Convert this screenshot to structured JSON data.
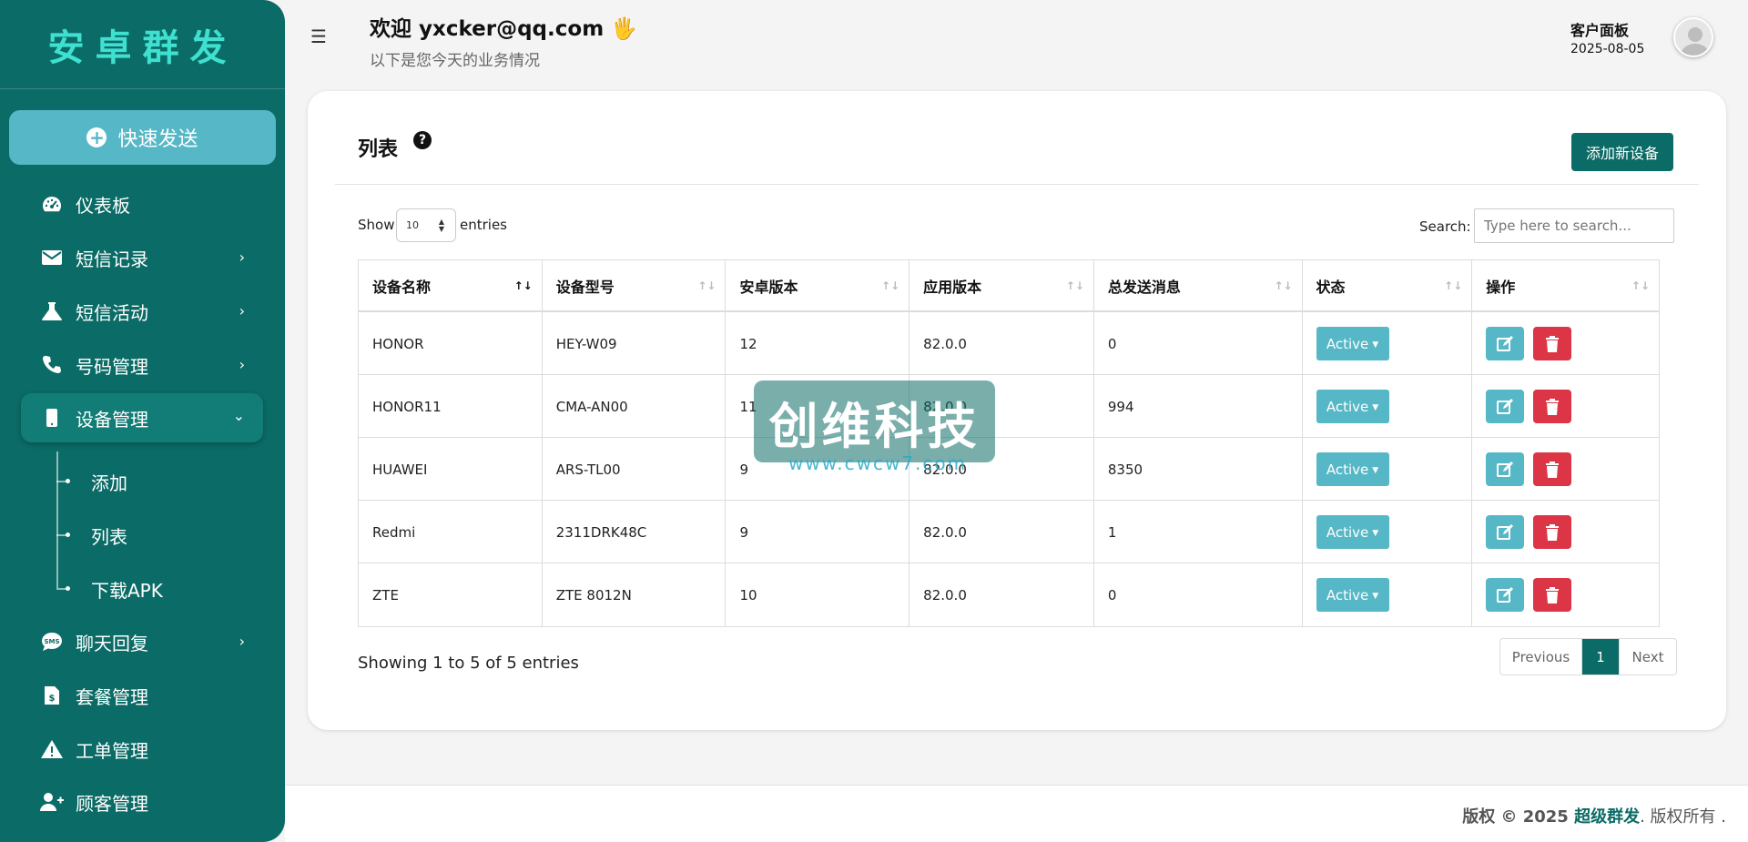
{
  "sidebar": {
    "brand": "安卓群发",
    "quick_send": "快速发送",
    "items": [
      {
        "label": "仪表板"
      },
      {
        "label": "短信记录"
      },
      {
        "label": "短信活动"
      },
      {
        "label": "号码管理"
      },
      {
        "label": "设备管理"
      },
      {
        "label": "聊天回复"
      },
      {
        "label": "套餐管理"
      },
      {
        "label": "工单管理"
      },
      {
        "label": "顾客管理"
      }
    ],
    "sub_items": [
      {
        "label": "添加"
      },
      {
        "label": "列表"
      },
      {
        "label": "下载APK"
      }
    ]
  },
  "header": {
    "welcome": "欢迎 yxcker@qq.com",
    "wave": "🖐",
    "subtitle": "以下是您今天的业务情况",
    "panel_label": "客户面板",
    "date": "2025-08-05"
  },
  "card": {
    "title": "列表",
    "add_button": "添加新设备",
    "show_label": "Show",
    "entries_value": "10",
    "entries_label": "entries",
    "search_label": "Search:",
    "search_placeholder": "Type here to search...",
    "columns": [
      "设备名称",
      "设备型号",
      "安卓版本",
      "应用版本",
      "总发送消息",
      "状态",
      "操作"
    ],
    "rows": [
      {
        "name": "HONOR",
        "model": "HEY-W09",
        "android": "12",
        "app": "82.0.0",
        "sent": "0",
        "status": "Active"
      },
      {
        "name": "HONOR11",
        "model": "CMA-AN00",
        "android": "11",
        "app": "82.0.0",
        "sent": "994",
        "status": "Active"
      },
      {
        "name": "HUAWEI",
        "model": "ARS-TL00",
        "android": "9",
        "app": "82.0.0",
        "sent": "8350",
        "status": "Active"
      },
      {
        "name": "Redmi",
        "model": "2311DRK48C",
        "android": "9",
        "app": "82.0.0",
        "sent": "1",
        "status": "Active"
      },
      {
        "name": "ZTE",
        "model": "ZTE 8012N",
        "android": "10",
        "app": "82.0.0",
        "sent": "0",
        "status": "Active"
      }
    ],
    "info": "Showing 1 to 5 of 5 entries",
    "pager": {
      "prev": "Previous",
      "page": "1",
      "next": "Next"
    }
  },
  "watermark": {
    "text": "创维科技",
    "url": "www.cwcw7.com"
  },
  "footer": {
    "prefix": "版权 © 2025 ",
    "brand": "超级群发",
    "suffix": ". 版权所有 ."
  },
  "colors": {
    "primary": "#0b6b66",
    "accent": "#56b7c6",
    "danger": "#dc3545"
  }
}
